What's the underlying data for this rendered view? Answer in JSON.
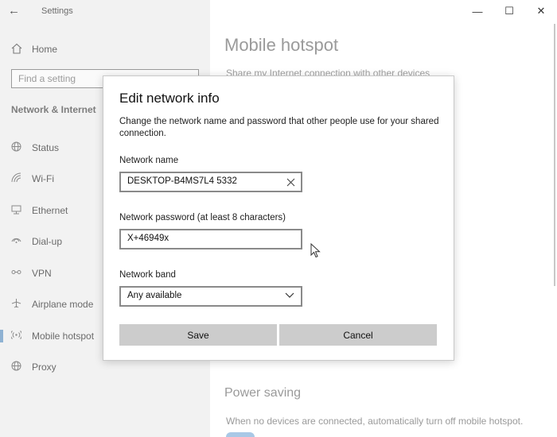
{
  "window": {
    "title": "Settings",
    "back_glyph": "←",
    "controls": {
      "minimize": "—",
      "maximize": "☐",
      "close": "✕"
    }
  },
  "sidebar": {
    "home": {
      "label": "Home",
      "icon": "home-icon"
    },
    "search": {
      "placeholder": "Find a setting"
    },
    "section_title": "Network & Internet",
    "items": [
      {
        "label": "Status",
        "icon": "globe-icon"
      },
      {
        "label": "Wi-Fi",
        "icon": "wifi-icon"
      },
      {
        "label": "Ethernet",
        "icon": "ethernet-icon"
      },
      {
        "label": "Dial-up",
        "icon": "dialup-icon"
      },
      {
        "label": "VPN",
        "icon": "vpn-icon"
      },
      {
        "label": "Airplane mode",
        "icon": "airplane-icon"
      },
      {
        "label": "Mobile hotspot",
        "icon": "hotspot-icon",
        "active": true
      },
      {
        "label": "Proxy",
        "icon": "globe-icon"
      }
    ]
  },
  "content": {
    "title": "Mobile hotspot",
    "subtitle": "Share my Internet connection with other devices",
    "power_saving": {
      "title": "Power saving",
      "description": "When no devices are connected, automatically turn off mobile hotspot."
    }
  },
  "dialog": {
    "title": "Edit network info",
    "description": "Change the network name and password that other people use for your shared connection.",
    "network_name": {
      "label": "Network name",
      "value": "DESKTOP-B4MS7L4 5332"
    },
    "network_password": {
      "label": "Network password (at least 8 characters)",
      "value": "X+46949x"
    },
    "network_band": {
      "label": "Network band",
      "value": "Any available"
    },
    "save_label": "Save",
    "cancel_label": "Cancel"
  },
  "colors": {
    "sidebar_bg": "#f2f2f2",
    "button_bg": "#cccccc",
    "active_marker": "#8fb2d3"
  }
}
